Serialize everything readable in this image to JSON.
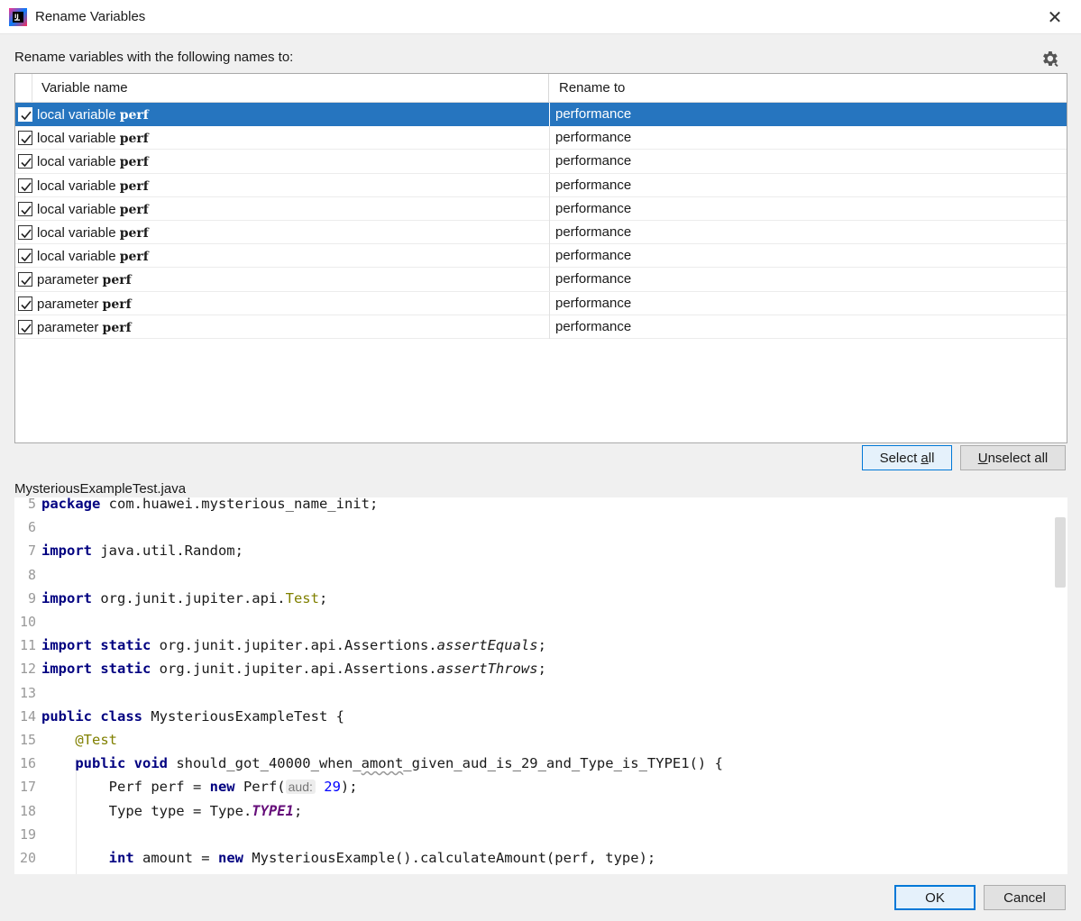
{
  "window": {
    "title": "Rename Variables",
    "close_glyph": "✕",
    "icon": "intellij-icon"
  },
  "prompt": "Rename variables with the following names to:",
  "settings_icon": "gear-icon",
  "table": {
    "columns": [
      "Variable name",
      "Rename to"
    ],
    "rows": [
      {
        "kind": "local variable",
        "name": "perf",
        "rename_to": "performance",
        "checked": true,
        "selected": true
      },
      {
        "kind": "local variable",
        "name": "perf",
        "rename_to": "performance",
        "checked": true,
        "selected": false
      },
      {
        "kind": "local variable",
        "name": "perf",
        "rename_to": "performance",
        "checked": true,
        "selected": false
      },
      {
        "kind": "local variable",
        "name": "perf",
        "rename_to": "performance",
        "checked": true,
        "selected": false
      },
      {
        "kind": "local variable",
        "name": "perf",
        "rename_to": "performance",
        "checked": true,
        "selected": false
      },
      {
        "kind": "local variable",
        "name": "perf",
        "rename_to": "performance",
        "checked": true,
        "selected": false
      },
      {
        "kind": "local variable",
        "name": "perf",
        "rename_to": "performance",
        "checked": true,
        "selected": false
      },
      {
        "kind": "parameter",
        "name": "perf",
        "rename_to": "performance",
        "checked": true,
        "selected": false
      },
      {
        "kind": "parameter",
        "name": "perf",
        "rename_to": "performance",
        "checked": true,
        "selected": false
      },
      {
        "kind": "parameter",
        "name": "perf",
        "rename_to": "performance",
        "checked": true,
        "selected": false
      }
    ]
  },
  "buttons": {
    "select_all": {
      "pre": "Select ",
      "mnemonic": "a",
      "post": "ll"
    },
    "unselect_all": {
      "pre": "",
      "mnemonic": "U",
      "post": "nselect all"
    },
    "ok": "OK",
    "cancel": "Cancel"
  },
  "preview": {
    "file_name": "MysteriousExampleTest.java",
    "lines": [
      {
        "n": "5",
        "tokens": [
          [
            "kw",
            "package"
          ],
          [
            "t",
            " com.huawei.mysterious_name_init;"
          ]
        ]
      },
      {
        "n": "6",
        "tokens": []
      },
      {
        "n": "7",
        "tokens": [
          [
            "kw",
            "import"
          ],
          [
            "t",
            " java.util.Random;"
          ]
        ]
      },
      {
        "n": "8",
        "tokens": []
      },
      {
        "n": "9",
        "tokens": [
          [
            "kw",
            "import"
          ],
          [
            "t",
            " org.junit.jupiter.api."
          ],
          [
            "ann",
            "Test"
          ],
          [
            "t",
            ";"
          ]
        ]
      },
      {
        "n": "10",
        "tokens": []
      },
      {
        "n": "11",
        "tokens": [
          [
            "kw",
            "import static"
          ],
          [
            "t",
            " org.junit.jupiter.api.Assertions."
          ],
          [
            "ital",
            "assertEquals"
          ],
          [
            "t",
            ";"
          ]
        ]
      },
      {
        "n": "12",
        "tokens": [
          [
            "kw",
            "import static"
          ],
          [
            "t",
            " org.junit.jupiter.api.Assertions."
          ],
          [
            "ital",
            "assertThrows"
          ],
          [
            "t",
            ";"
          ]
        ]
      },
      {
        "n": "13",
        "tokens": []
      },
      {
        "n": "14",
        "tokens": [
          [
            "kw",
            "public class"
          ],
          [
            "t",
            " MysteriousExampleTest {"
          ]
        ]
      },
      {
        "n": "15",
        "tokens": [
          [
            "t",
            "    "
          ],
          [
            "ann",
            "@Test"
          ]
        ]
      },
      {
        "n": "16",
        "tokens": [
          [
            "t",
            "    "
          ],
          [
            "kw",
            "public void"
          ],
          [
            "t",
            " should_got_40000_when_"
          ],
          [
            "squig",
            "amont"
          ],
          [
            "t",
            "_given_aud_is_29_and_Type_is_TYPE1() {"
          ]
        ]
      },
      {
        "n": "17",
        "tokens": [
          [
            "t",
            "        Perf perf = "
          ],
          [
            "kw",
            "new"
          ],
          [
            "t",
            " Perf("
          ],
          [
            "hint",
            "aud:"
          ],
          [
            "t",
            " "
          ],
          [
            "num",
            "29"
          ],
          [
            "t",
            ");"
          ]
        ]
      },
      {
        "n": "18",
        "tokens": [
          [
            "t",
            "        Type type = Type."
          ],
          [
            "const",
            "TYPE1"
          ],
          [
            "t",
            ";"
          ]
        ]
      },
      {
        "n": "19",
        "tokens": []
      },
      {
        "n": "20",
        "tokens": [
          [
            "t",
            "        "
          ],
          [
            "kw",
            "int"
          ],
          [
            "t",
            " amount = "
          ],
          [
            "kw",
            "new"
          ],
          [
            "t",
            " MysteriousExample().calculateAmount(perf, type);"
          ]
        ]
      }
    ]
  },
  "colors": {
    "selection": "#2675bf",
    "keyword": "#000080",
    "annotation": "#808000",
    "constant": "#660e7a",
    "number": "#0000ff",
    "default_button_border": "#0078d7"
  }
}
